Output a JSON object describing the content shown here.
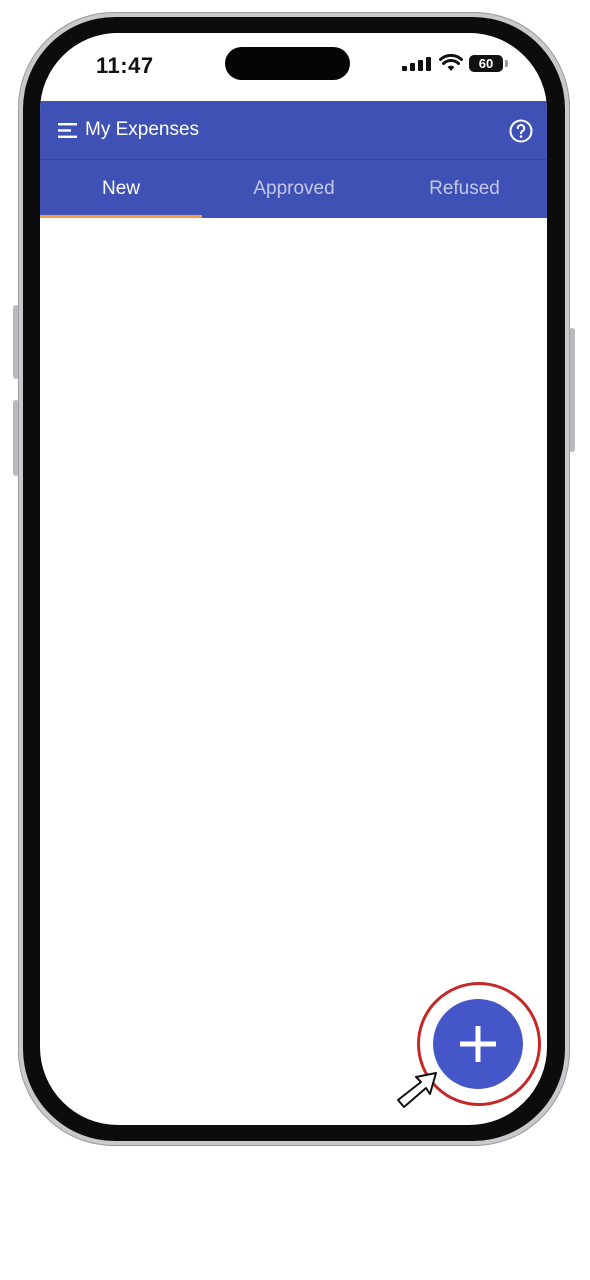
{
  "status_bar": {
    "time": "11:47",
    "battery": "60"
  },
  "app_bar": {
    "title": "My Expenses",
    "color": "#3f51b5"
  },
  "tabs": [
    {
      "label": "New",
      "selected": true
    },
    {
      "label": "Approved",
      "selected": false
    },
    {
      "label": "Refused",
      "selected": false
    }
  ],
  "colors": {
    "tab_indicator": "#f0a040",
    "fab": "#4557c8",
    "highlight": "#c62828"
  },
  "icons": {
    "menu": "menu-icon",
    "help": "help-icon",
    "fab": "plus-icon",
    "cursor": "cursor-arrow-icon"
  }
}
